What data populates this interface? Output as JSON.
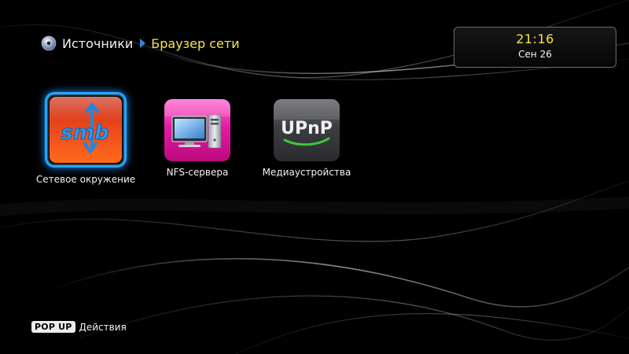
{
  "breadcrumb": {
    "icon": "disc-icon",
    "parent": "Источники",
    "current": "Браузер сети"
  },
  "clock": {
    "time": "21:16",
    "date": "Сен 26"
  },
  "tiles": [
    {
      "label": "Сетевое окружение",
      "icon": "smb-icon",
      "selected": true,
      "icon_text": "smb"
    },
    {
      "label": "NFS-сервера",
      "icon": "nfs-server-icon",
      "selected": false
    },
    {
      "label": "Медиаустройства",
      "icon": "upnp-icon",
      "selected": false,
      "icon_text": "UPnP"
    }
  ],
  "hint": {
    "key": "POP UP",
    "label": "Действия"
  },
  "colors": {
    "accent_yellow": "#f3e64a",
    "selection_blue": "#22a6ff",
    "smb_red": "#e8341c",
    "nfs_magenta": "#e0189a"
  }
}
